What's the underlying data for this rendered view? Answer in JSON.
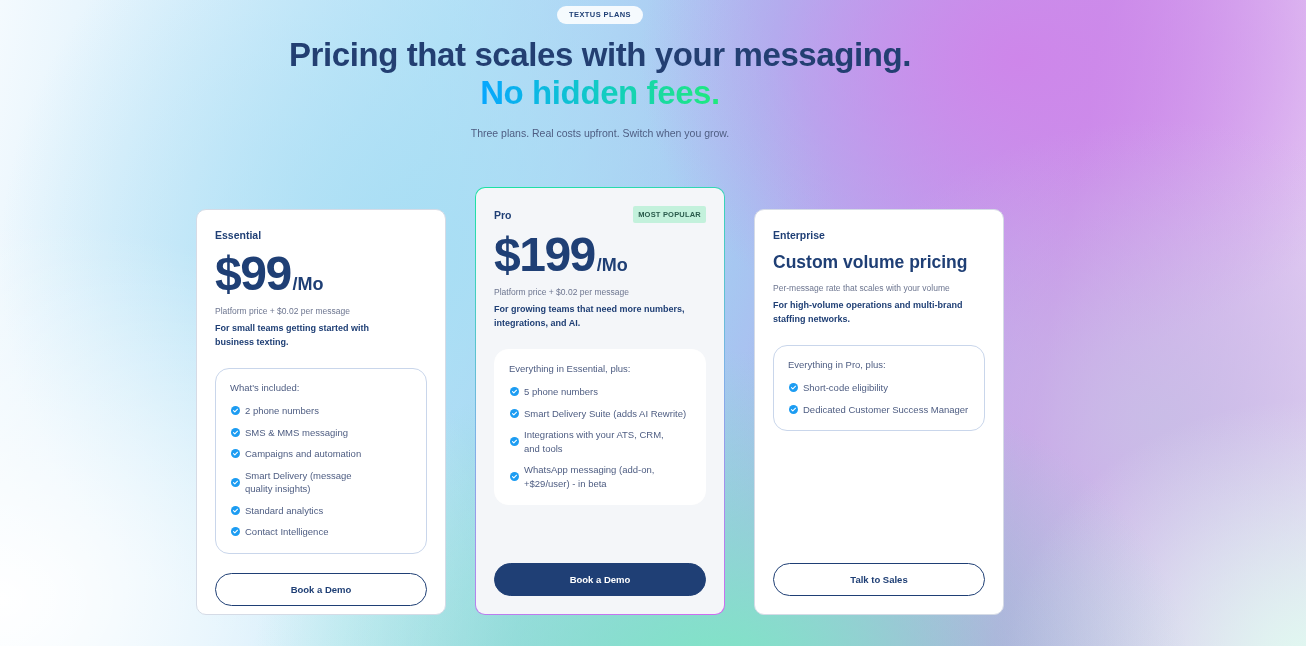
{
  "header": {
    "eyebrow": "TEXTUS PLANS",
    "title": "Pricing that scales with your messaging.",
    "title_accent": "No hidden fees.",
    "subtitle": "Three plans. Real costs upfront. Switch when you grow."
  },
  "plans": [
    {
      "name": "Essential",
      "highlighted": false,
      "price": {
        "amount": "$99",
        "period": "/Mo"
      },
      "price_note": "Platform price + $0.02 per message",
      "description": "For small teams getting started with\nbusiness texting.",
      "features_title": "What's included:",
      "features": [
        "2 phone numbers",
        "SMS & MMS messaging",
        "Campaigns and automation",
        "Smart Delivery (message\nquality insights)",
        "Standard analytics",
        "Contact Intelligence"
      ],
      "button": {
        "label": "Book a Demo",
        "kind": "outline"
      }
    },
    {
      "name": "Pro",
      "highlighted": true,
      "badge": "MOST POPULAR",
      "price": {
        "amount": "$199",
        "period": "/Mo"
      },
      "price_note": "Platform price + $0.02 per message",
      "description": "For growing teams that need more numbers,\nintegrations, and AI.",
      "features_title": "Everything in Essential, plus:",
      "features": [
        "5 phone numbers",
        "Smart Delivery Suite (adds AI Rewrite)",
        "Integrations with your ATS, CRM,\nand tools",
        "WhatsApp messaging (add-on,\n+$29/user) - in beta"
      ],
      "button": {
        "label": "Book a Demo",
        "kind": "primary"
      }
    },
    {
      "name": "Enterprise",
      "highlighted": false,
      "headline": "Custom volume pricing",
      "price_note": "Per-message rate that scales with your volume",
      "description": "For high-volume operations and multi-brand\nstaffing networks.",
      "features_title": "Everything in Pro, plus:",
      "features": [
        "Short-code eligibility",
        "Dedicated Customer Success Manager"
      ],
      "button": {
        "label": "Talk to Sales",
        "kind": "outline"
      }
    }
  ]
}
